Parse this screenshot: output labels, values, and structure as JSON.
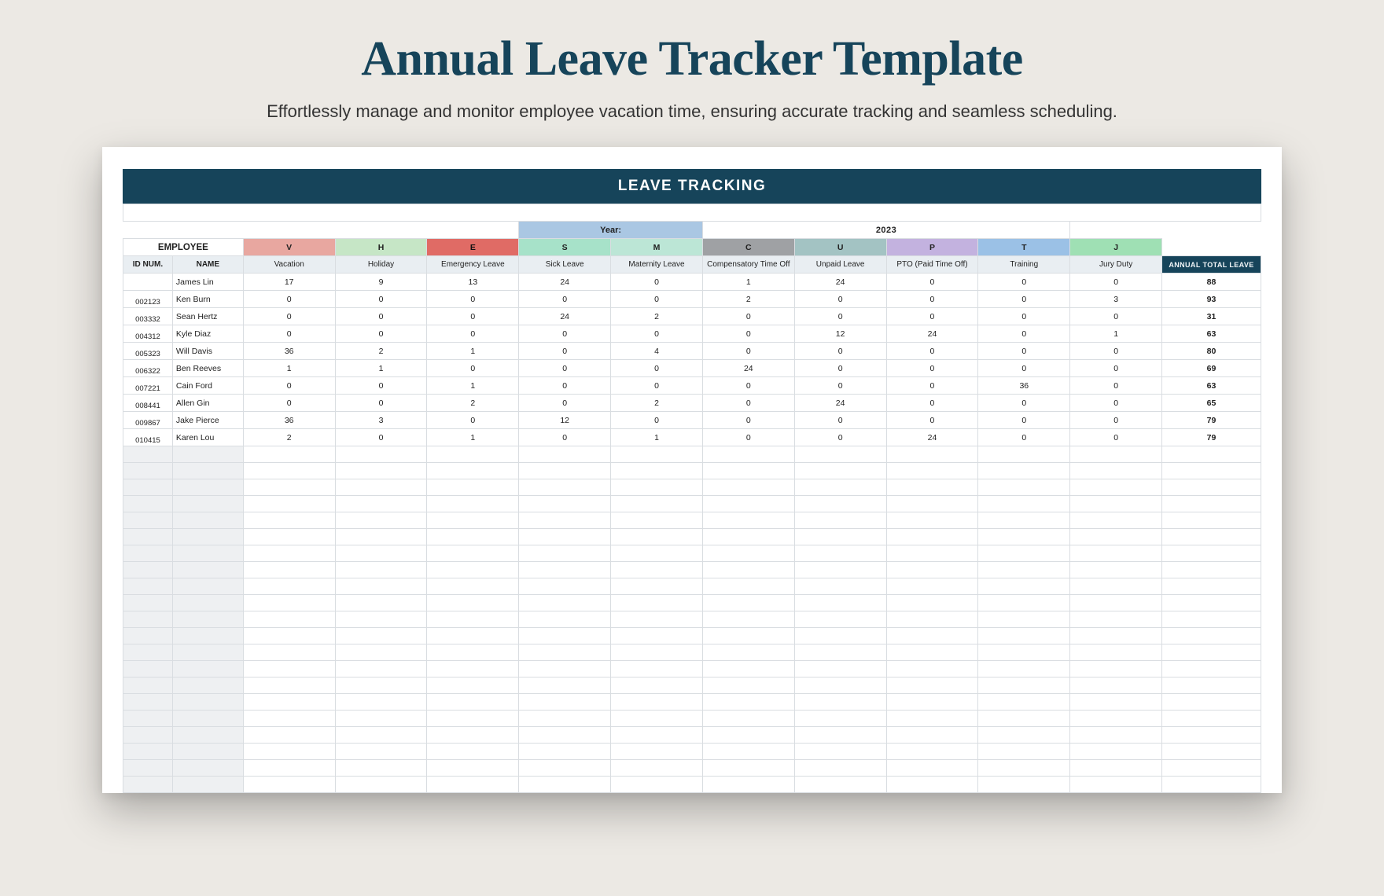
{
  "page": {
    "title": "Annual Leave Tracker Template",
    "subtitle": "Effortlessly manage and monitor employee vacation time, ensuring accurate tracking and seamless scheduling."
  },
  "sheet": {
    "banner": "LEAVE TRACKING",
    "year_label": "Year:",
    "year_value": "2023",
    "employee_header": "EMPLOYEE",
    "id_header": "ID NUM.",
    "name_header": "NAME",
    "total_header": "ANNUAL TOTAL LEAVE",
    "types": [
      {
        "code": "V",
        "label": "Vacation",
        "class": "code-V"
      },
      {
        "code": "H",
        "label": "Holiday",
        "class": "code-H"
      },
      {
        "code": "E",
        "label": "Emergency Leave",
        "class": "code-E"
      },
      {
        "code": "S",
        "label": "Sick Leave",
        "class": "code-S"
      },
      {
        "code": "M",
        "label": "Maternity Leave",
        "class": "code-M"
      },
      {
        "code": "C",
        "label": "Compensatory Time Off",
        "class": "code-C"
      },
      {
        "code": "U",
        "label": "Unpaid Leave",
        "class": "code-U"
      },
      {
        "code": "P",
        "label": "PTO (Paid Time Off)",
        "class": "code-P"
      },
      {
        "code": "T",
        "label": "Training",
        "class": "code-T"
      },
      {
        "code": "J",
        "label": "Jury Duty",
        "class": "code-J"
      }
    ],
    "rows": [
      {
        "id": "",
        "name": "James Lin",
        "v": [
          17,
          9,
          13,
          24,
          0,
          1,
          24,
          0,
          0,
          0
        ],
        "total": 88
      },
      {
        "id": "002123",
        "name": "Ken Burn",
        "v": [
          0,
          0,
          0,
          0,
          0,
          2,
          0,
          0,
          0,
          3
        ],
        "total": 93
      },
      {
        "id": "003332",
        "name": "Sean Hertz",
        "v": [
          0,
          0,
          0,
          24,
          2,
          0,
          0,
          0,
          0,
          0
        ],
        "total": 31
      },
      {
        "id": "004312",
        "name": "Kyle Diaz",
        "v": [
          0,
          0,
          0,
          0,
          0,
          0,
          12,
          24,
          0,
          1
        ],
        "total": 63
      },
      {
        "id": "005323",
        "name": "Will Davis",
        "v": [
          36,
          2,
          1,
          0,
          4,
          0,
          0,
          0,
          0,
          0
        ],
        "total": 80
      },
      {
        "id": "006322",
        "name": "Ben Reeves",
        "v": [
          1,
          1,
          0,
          0,
          0,
          24,
          0,
          0,
          0,
          0
        ],
        "total": 69
      },
      {
        "id": "007221",
        "name": "Cain Ford",
        "v": [
          0,
          0,
          1,
          0,
          0,
          0,
          0,
          0,
          36,
          0
        ],
        "total": 63
      },
      {
        "id": "008441",
        "name": "Allen Gin",
        "v": [
          0,
          0,
          2,
          0,
          2,
          0,
          24,
          0,
          0,
          0
        ],
        "total": 65
      },
      {
        "id": "009867",
        "name": "Jake Pierce",
        "v": [
          36,
          3,
          0,
          12,
          0,
          0,
          0,
          0,
          0,
          0
        ],
        "total": 79
      },
      {
        "id": "010415",
        "name": "Karen Lou",
        "v": [
          2,
          0,
          1,
          0,
          1,
          0,
          0,
          24,
          0,
          0
        ],
        "total": 79
      }
    ],
    "empty_row_count": 21
  }
}
